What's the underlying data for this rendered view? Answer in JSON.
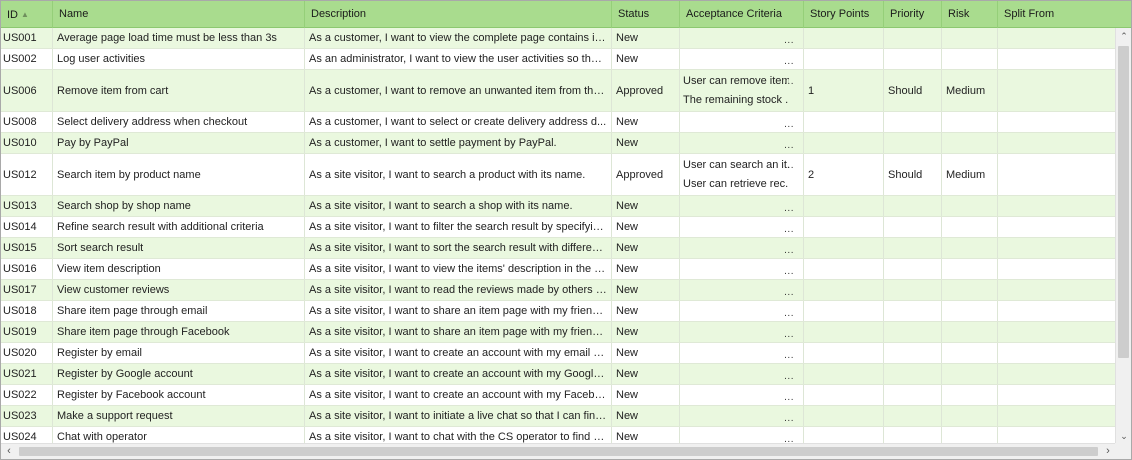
{
  "columns": [
    {
      "key": "id",
      "label": "ID",
      "sort": "ascending"
    },
    {
      "key": "name",
      "label": "Name"
    },
    {
      "key": "description",
      "label": "Description"
    },
    {
      "key": "status",
      "label": "Status"
    },
    {
      "key": "acceptance_criteria",
      "label": "Acceptance Criteria"
    },
    {
      "key": "story_points",
      "label": "Story Points"
    },
    {
      "key": "priority",
      "label": "Priority"
    },
    {
      "key": "risk",
      "label": "Risk"
    },
    {
      "key": "split_from",
      "label": "Split From"
    }
  ],
  "sort_icon": "sort-ascending-icon",
  "ellipsis": "...",
  "rows": [
    {
      "id": "US001",
      "name": "Average page load time must be less than 3s",
      "description": "As a customer, I want to view the complete page contains in ...",
      "status": "New",
      "acceptance_criteria": [],
      "story_points": "",
      "priority": "",
      "risk": "",
      "split_from": ""
    },
    {
      "id": "US002",
      "name": "Log user activities",
      "description": "As an administrator, I want to view the user activities so that ...",
      "status": "New",
      "acceptance_criteria": [],
      "story_points": "",
      "priority": "",
      "risk": "",
      "split_from": ""
    },
    {
      "id": "US006",
      "name": "Remove item from cart",
      "description": "As a customer, I want to remove an unwanted item from the ...",
      "status": "Approved",
      "acceptance_criteria": [
        "User can remove item...",
        "The remaining stock ..."
      ],
      "story_points": "1",
      "priority": "Should",
      "risk": "Medium",
      "split_from": ""
    },
    {
      "id": "US008",
      "name": "Select delivery address when checkout",
      "description": "As a customer, I want to select or create delivery address d...",
      "status": "New",
      "acceptance_criteria": [],
      "story_points": "",
      "priority": "",
      "risk": "",
      "split_from": ""
    },
    {
      "id": "US010",
      "name": "Pay by PayPal",
      "description": "As a customer, I want to settle payment by PayPal.",
      "status": "New",
      "acceptance_criteria": [],
      "story_points": "",
      "priority": "",
      "risk": "",
      "split_from": ""
    },
    {
      "id": "US012",
      "name": "Search item by product name",
      "description": "As a site visitor, I want to search a product with its name.",
      "status": "Approved",
      "acceptance_criteria": [
        "User can search an it...",
        "User can retrieve rec..."
      ],
      "story_points": "2",
      "priority": "Should",
      "risk": "Medium",
      "split_from": ""
    },
    {
      "id": "US013",
      "name": "Search shop by shop name",
      "description": "As a site visitor, I want to search a shop with its name.",
      "status": "New",
      "acceptance_criteria": [],
      "story_points": "",
      "priority": "",
      "risk": "",
      "split_from": ""
    },
    {
      "id": "US014",
      "name": "Refine search result with additional criteria",
      "description": "As a site visitor, I want to filter the search result by specifyin...",
      "status": "New",
      "acceptance_criteria": [],
      "story_points": "",
      "priority": "",
      "risk": "",
      "split_from": ""
    },
    {
      "id": "US015",
      "name": "Sort search result",
      "description": "As a site visitor, I want to sort the search result with differen...",
      "status": "New",
      "acceptance_criteria": [],
      "story_points": "",
      "priority": "",
      "risk": "",
      "split_from": ""
    },
    {
      "id": "US016",
      "name": "View item description",
      "description": "As a site visitor, I want to view the items' description in the pr...",
      "status": "New",
      "acceptance_criteria": [],
      "story_points": "",
      "priority": "",
      "risk": "",
      "split_from": ""
    },
    {
      "id": "US017",
      "name": "View customer reviews",
      "description": "As a site visitor, I want to read the reviews made by others f...",
      "status": "New",
      "acceptance_criteria": [],
      "story_points": "",
      "priority": "",
      "risk": "",
      "split_from": ""
    },
    {
      "id": "US018",
      "name": "Share item page through email",
      "description": "As a site visitor, I want to share an item page with my friends...",
      "status": "New",
      "acceptance_criteria": [],
      "story_points": "",
      "priority": "",
      "risk": "",
      "split_from": ""
    },
    {
      "id": "US019",
      "name": "Share item page through Facebook",
      "description": "As a site visitor, I want to share an item page with my friends...",
      "status": "New",
      "acceptance_criteria": [],
      "story_points": "",
      "priority": "",
      "risk": "",
      "split_from": ""
    },
    {
      "id": "US020",
      "name": "Register by email",
      "description": "As a site visitor, I want to create an account with my email a...",
      "status": "New",
      "acceptance_criteria": [],
      "story_points": "",
      "priority": "",
      "risk": "",
      "split_from": ""
    },
    {
      "id": "US021",
      "name": "Register by Google account",
      "description": "As a site visitor, I want to create an account with my Google ...",
      "status": "New",
      "acceptance_criteria": [],
      "story_points": "",
      "priority": "",
      "risk": "",
      "split_from": ""
    },
    {
      "id": "US022",
      "name": "Register by Facebook account",
      "description": "As a site visitor, I want to create an account with my Facebo...",
      "status": "New",
      "acceptance_criteria": [],
      "story_points": "",
      "priority": "",
      "risk": "",
      "split_from": ""
    },
    {
      "id": "US023",
      "name": "Make a support request",
      "description": "As a site visitor, I want to initiate a live chat so that I can find ...",
      "status": "New",
      "acceptance_criteria": [],
      "story_points": "",
      "priority": "",
      "risk": "",
      "split_from": ""
    },
    {
      "id": "US024",
      "name": "Chat with operator",
      "description": "As a site visitor, I want to chat with the CS operator to find h...",
      "status": "New",
      "acceptance_criteria": [],
      "story_points": "",
      "priority": "",
      "risk": "",
      "split_from": ""
    }
  ],
  "scrollbars": {
    "up_icon": "scroll-up-arrow-icon",
    "down_icon": "scroll-down-arrow-icon",
    "left_icon": "scroll-left-arrow-icon",
    "right_icon": "scroll-right-arrow-icon"
  }
}
